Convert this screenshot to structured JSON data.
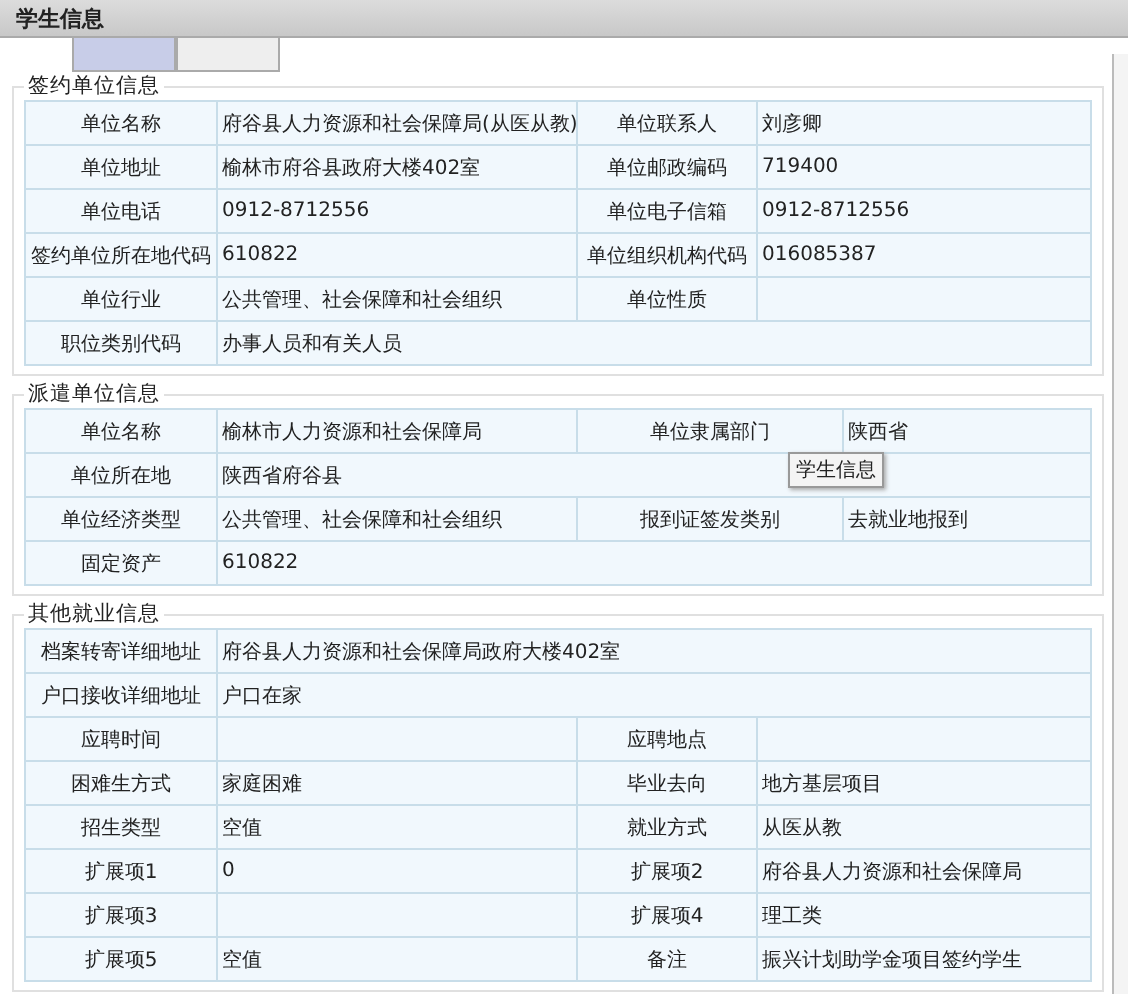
{
  "header": {
    "title": "学生信息"
  },
  "tabs": [
    {
      "selected": true
    },
    {
      "selected": false
    }
  ],
  "sections": [
    {
      "legend": "签约单位信息",
      "rows": [
        {
          "cells": [
            {
              "label": "单位名称",
              "value": "府谷县人力资源和社会保障局(从医从教)"
            },
            {
              "label": "单位联系人",
              "value": "刘彦卿"
            }
          ]
        },
        {
          "cells": [
            {
              "label": "单位地址",
              "value": "榆林市府谷县政府大楼402室"
            },
            {
              "label": "单位邮政编码",
              "value": "719400"
            }
          ]
        },
        {
          "cells": [
            {
              "label": "单位电话",
              "value": "0912-8712556"
            },
            {
              "label": "单位电子信箱",
              "value": "0912-8712556"
            }
          ]
        },
        {
          "cells": [
            {
              "label": "签约单位所在地代码",
              "value": "610822"
            },
            {
              "label": "单位组织机构代码",
              "value": "016085387"
            }
          ]
        },
        {
          "cells": [
            {
              "label": "单位行业",
              "value": "公共管理、社会保障和社会组织"
            },
            {
              "label": "单位性质"
            }
          ]
        },
        {
          "cells": [
            {
              "label": "职位类别代码",
              "value": "办事人员和有关人员"
            }
          ]
        }
      ]
    },
    {
      "legend": "派遣单位信息",
      "rows": [
        {
          "cells": [
            {
              "label": "单位名称",
              "value": "榆林市人力资源和社会保障局"
            },
            {
              "label": "单位隶属部门",
              "value": "陕西省"
            }
          ]
        },
        {
          "cells": [
            {
              "label": "单位所在地",
              "value": "陕西省府谷县"
            }
          ]
        },
        {
          "cells": [
            {
              "label": "单位经济类型",
              "value": "公共管理、社会保障和社会组织"
            },
            {
              "label": "报到证签发类别",
              "value": "去就业地报到"
            }
          ]
        },
        {
          "cells": [
            {
              "label": "固定资产",
              "value": "610822"
            }
          ]
        }
      ]
    },
    {
      "legend": "其他就业信息",
      "rows": [
        {
          "cells": [
            {
              "label": "档案转寄详细地址",
              "value": "府谷县人力资源和社会保障局政府大楼402室"
            }
          ]
        },
        {
          "cells": [
            {
              "label": "户口接收详细地址",
              "value": "户口在家"
            }
          ]
        },
        {
          "cells": [
            {
              "label": "应聘时间"
            },
            {
              "label": "应聘地点"
            }
          ]
        },
        {
          "cells": [
            {
              "label": "困难生方式",
              "value": "家庭困难"
            },
            {
              "label": "毕业去向",
              "value": "地方基层项目"
            }
          ]
        },
        {
          "cells": [
            {
              "label": "招生类型",
              "value": "空值"
            },
            {
              "label": "就业方式",
              "value": "从医从教"
            }
          ]
        },
        {
          "cells": [
            {
              "label": "扩展项1",
              "value": "0"
            },
            {
              "label": "扩展项2",
              "value": "府谷县人力资源和社会保障局"
            }
          ]
        },
        {
          "cells": [
            {
              "label": "扩展项3"
            },
            {
              "label": "扩展项4",
              "value": "理工类"
            }
          ]
        },
        {
          "cells": [
            {
              "label": "扩展项5",
              "value": "空值"
            },
            {
              "label": "备注",
              "value": "振兴计划助学金项目签约学生"
            }
          ]
        }
      ]
    }
  ],
  "tooltip": {
    "text": "学生信息"
  }
}
